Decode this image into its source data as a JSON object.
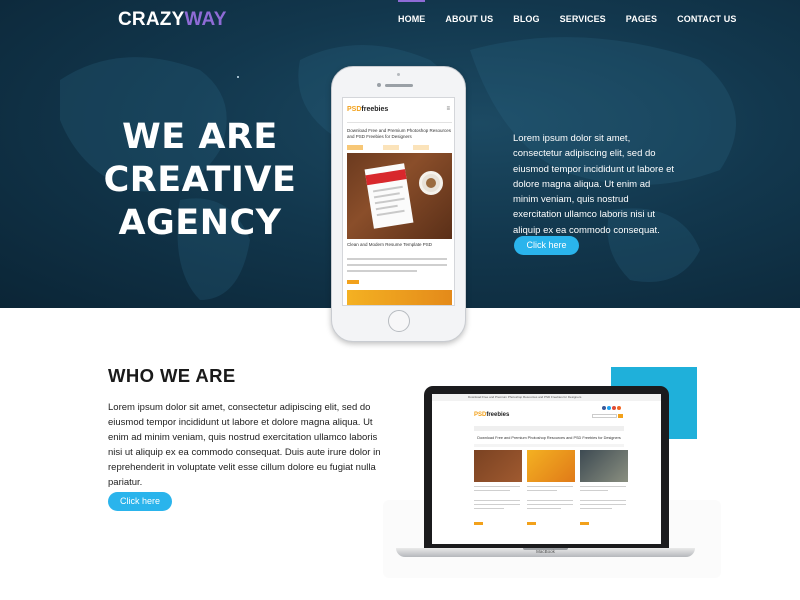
{
  "brand": {
    "logo_part1": "CRAZY",
    "logo_part2": "WAY"
  },
  "nav": [
    {
      "label": "HOME",
      "active": true
    },
    {
      "label": "ABOUT US"
    },
    {
      "label": "BLOG"
    },
    {
      "label": "SERVICES"
    },
    {
      "label": "PAGES"
    },
    {
      "label": "CONTACT US"
    }
  ],
  "hero": {
    "title_line1": "WE ARE",
    "title_line2": "CREATIVE",
    "title_line3": "AGENCY",
    "text": "Lorem ipsum dolor sit amet, consectetur adipiscing elit, sed do eiusmod tempor incididunt ut labore et dolore magna aliqua. Ut enim ad minim veniam, quis nostrud exercitation ullamco laboris nisi ut aliquip ex ea commodo consequat.",
    "button": "Click here"
  },
  "phone_screen": {
    "logo_part1": "PSD",
    "logo_part2": "freebies",
    "headline": "Download Free and Premium Photoshop Resources and PSD Freebies for Designers",
    "caption": "Clean and Modern Resume Template PSD"
  },
  "about": {
    "title": "WHO WE ARE",
    "text": "Lorem ipsum dolor sit amet, consectetur adipiscing elit, sed do eiusmod tempor incididunt ut labore et dolore magna aliqua. Ut enim ad minim veniam, quis nostrud exercitation ullamco laboris nisi ut aliquip ex ea commodo consequat. Duis aute irure dolor in reprehenderit in voluptate velit esse cillum dolore eu fugiat nulla pariatur.",
    "button": "Click here"
  },
  "laptop_screen": {
    "logo_part1": "PSD",
    "logo_part2": "freebies",
    "heading": "Download Free and Premium Photoshop Resources and PSD Freebies for Designers",
    "base_label": "MacBook"
  },
  "colors": {
    "accent": "#8e6bd6",
    "button": "#2ab4ec",
    "cyan_block": "#1fb0da",
    "hero_bg": "#12374d"
  }
}
